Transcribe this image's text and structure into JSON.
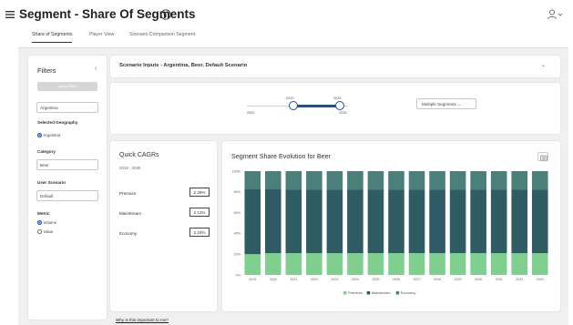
{
  "header": {
    "title": "Segment - Share Of Segments"
  },
  "tabs": [
    {
      "label": "Share of Segments",
      "active": true
    },
    {
      "label": "Player View",
      "active": false
    },
    {
      "label": "Scenario Comparison Segment",
      "active": false
    }
  ],
  "filters": {
    "title": "Filters",
    "apply_label": "Apply Filter",
    "geography_value": "Argentina",
    "selected_geography_label": "Selected Geography",
    "selected_geography_option": "Argentina",
    "category_label": "Category",
    "category_value": "Beer",
    "user_scenario_label": "User Scenario",
    "user_scenario_value": "Default",
    "metric_label": "Metric",
    "metric_options": [
      {
        "label": "Volume",
        "selected": true
      },
      {
        "label": "Value",
        "selected": false
      }
    ]
  },
  "scenario": {
    "text": "Scenario Inputs - Argentina, Beer, Default Scenario"
  },
  "slider": {
    "min_label": "2000",
    "max_label": "2035",
    "start_value": "2019",
    "end_value": "2033",
    "segment_select": "Multiple Segments"
  },
  "cagr": {
    "title": "Quick CAGRs",
    "period": "2019 - 2035",
    "rows": [
      {
        "label": "Premium",
        "value": "2.29%"
      },
      {
        "label": "Mainstream",
        "value": "2.12%"
      },
      {
        "label": "Economy",
        "value": "2.24%"
      }
    ]
  },
  "chart": {
    "title": "Segment Share Evolution for Beer"
  },
  "chart_data": {
    "type": "bar",
    "stacked": true,
    "title": "Segment Share Evolution for Beer",
    "categories": [
      "2019",
      "2020",
      "2021",
      "2022",
      "2023",
      "2024",
      "2025",
      "2026",
      "2027",
      "2028",
      "2029",
      "2030",
      "2031",
      "2032",
      "2033"
    ],
    "ylim": [
      0,
      100
    ],
    "y_ticks": [
      "0%-",
      "20%-",
      "40%-",
      "60%-",
      "80%-",
      "100%-"
    ],
    "series": [
      {
        "name": "Premium",
        "color": "#7fcf8f",
        "values": [
          20,
          21,
          21,
          21,
          21,
          21,
          21,
          21,
          21,
          21,
          21,
          21,
          21,
          21,
          21
        ]
      },
      {
        "name": "Mainstream",
        "color": "#2f5b62",
        "values": [
          63,
          62,
          61,
          61,
          61,
          61,
          61,
          61,
          61,
          61,
          61,
          61,
          61,
          61,
          61
        ]
      },
      {
        "name": "Economy",
        "color": "#4a7f7a",
        "values": [
          17,
          17,
          18,
          18,
          18,
          18,
          18,
          18,
          18,
          18,
          18,
          18,
          18,
          18,
          18
        ]
      }
    ],
    "legend_position": "bottom"
  },
  "footer": {
    "link_label": "Why is this important to me?"
  }
}
